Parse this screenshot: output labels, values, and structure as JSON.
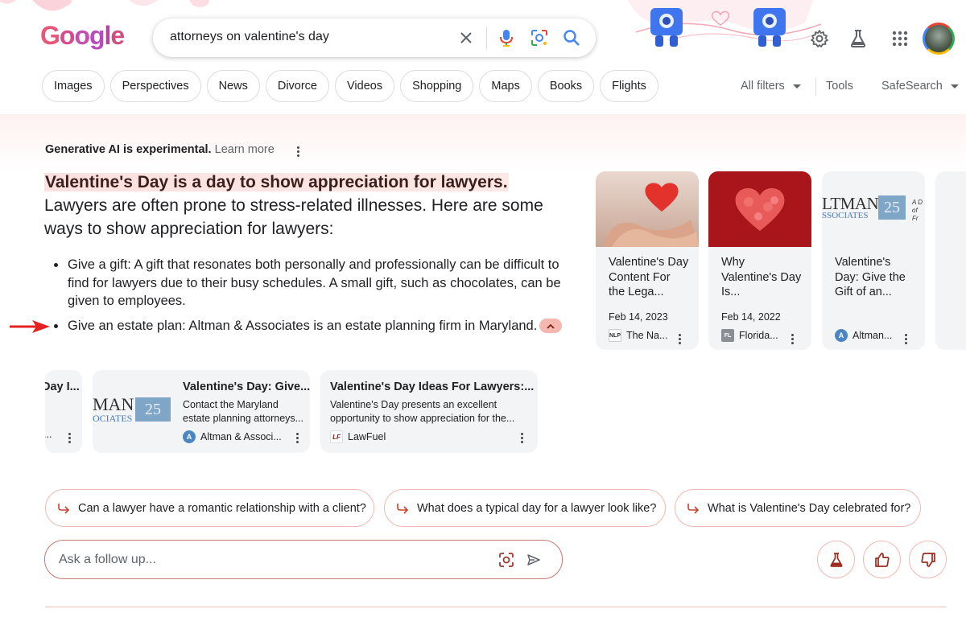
{
  "header": {
    "logo_letters": [
      {
        "ch": "G",
        "color": "#e8577a"
      },
      {
        "ch": "o",
        "color": "#d84a8c"
      },
      {
        "ch": "o",
        "color": "#c44fae"
      },
      {
        "ch": "g",
        "color": "#b74cbc"
      },
      {
        "ch": "l",
        "color": "#b0479a"
      },
      {
        "ch": "e",
        "color": "#d14f7c"
      }
    ],
    "search_query": "attorneys on valentine's day",
    "icons": [
      "close-icon",
      "mic-icon",
      "lens-icon",
      "search-icon",
      "gear-icon",
      "labs-flask-icon",
      "apps-grid-icon"
    ]
  },
  "filters": {
    "chips": [
      "Images",
      "Perspectives",
      "News",
      "Divorce",
      "Videos",
      "Shopping",
      "Maps",
      "Books",
      "Flights"
    ],
    "all_filters": "All filters",
    "tools": "Tools",
    "safesearch": "SafeSearch"
  },
  "ai_overview": {
    "label_bold": "Generative AI is experimental.",
    "label_link": "Learn more",
    "summary_highlight": "Valentine's Day is a day to show appreciation for lawyers.",
    "summary_rest": " Lawyers are often prone to stress-related illnesses. Here are some ways to show appreciation for lawyers:",
    "bullets": [
      "Give a gift: A gift that resonates both personally and professionally can be difficult to find for lawyers due to their busy schedules. A small gift, such as chocolates, can be given to employees.",
      "Give an estate plan: Altman & Associates is an estate planning firm in Maryland."
    ],
    "accent_color": "#e8453c"
  },
  "source_cards": [
    {
      "title": "Valentine's Day Content For the Lega...",
      "date": "Feb 14, 2023",
      "site": "The Na...",
      "favicon": "NLP",
      "image": "hands-heart"
    },
    {
      "title": "Why Valentine's Day Is...",
      "date": "Feb 14, 2022",
      "site": "Florida...",
      "favicon": "FL",
      "image": "red-heart"
    },
    {
      "title": "Valentine's Day: Give the Gift of an...",
      "date": "",
      "site": "Altman...",
      "favicon": "A",
      "image": "altman-logo"
    }
  ],
  "bottom_cards": [
    {
      "partial_title": "Day I...",
      "partial_site": "..."
    },
    {
      "title": "Valentine's Day: Give...",
      "snippet": "Contact the Maryland estate planning attorneys...",
      "site": "Altman & Associ...",
      "favicon": "A",
      "logo_text": "MAN",
      "logo_sub": "OCIATES",
      "logo_num": "25"
    },
    {
      "title": "Valentine's Day Ideas For Lawyers:...",
      "snippet": "Valentine's Day presents an excellent opportunity to show appreciation for the...",
      "site": "LawFuel",
      "favicon": "LF"
    }
  ],
  "altman_logo": {
    "text": "LTMAN",
    "sub": "SSOCIATES",
    "num": "25",
    "tag": "A D",
    "tag2": "of Fr"
  },
  "suggestions": [
    "Can a lawyer have a romantic relationship with a client?",
    "What does a typical day for a lawyer look like?",
    "What is Valentine's Day celebrated for?"
  ],
  "followup": {
    "placeholder": "Ask a follow up...",
    "icons": [
      "lens-icon",
      "send-icon"
    ]
  },
  "feedback_icons": [
    "labs-flask-icon",
    "thumbs-up-icon",
    "thumbs-down-icon"
  ]
}
